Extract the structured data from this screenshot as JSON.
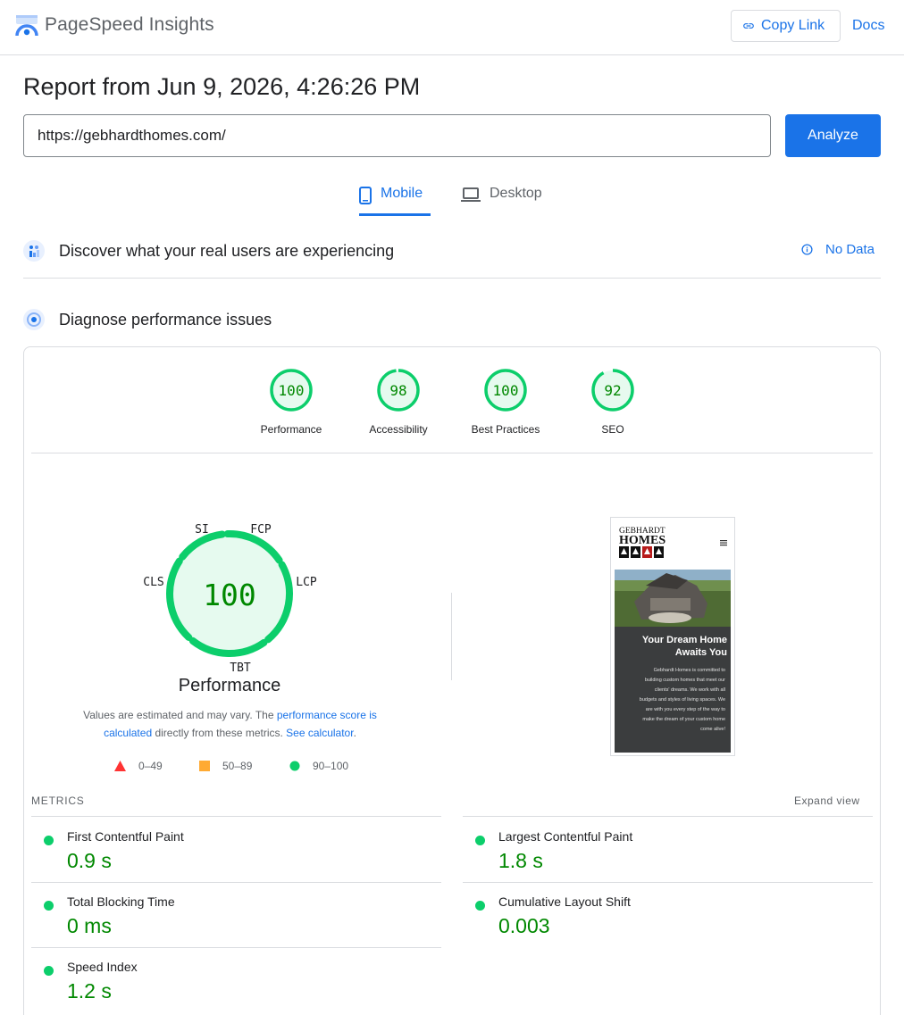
{
  "header": {
    "brand": "PageSpeed Insights",
    "copy_link": "Copy Link",
    "docs": "Docs"
  },
  "report": {
    "title": "Report from Jun 9, 2026, 4:26:26 PM",
    "url": "https://gebhardthomes.com/",
    "analyze": "Analyze"
  },
  "tabs": [
    {
      "label": "Mobile",
      "selected": true
    },
    {
      "label": "Desktop",
      "selected": false
    }
  ],
  "field_data": {
    "title": "Discover what your real users are experiencing",
    "status": "No Data"
  },
  "diagnose": {
    "title": "Diagnose performance issues"
  },
  "scores": [
    {
      "label": "Performance",
      "value": "100",
      "fraction": 1.0
    },
    {
      "label": "Accessibility",
      "value": "98",
      "fraction": 0.98
    },
    {
      "label": "Best Practices",
      "value": "100",
      "fraction": 1.0
    },
    {
      "label": "SEO",
      "value": "92",
      "fraction": 0.92
    }
  ],
  "performance": {
    "score": "100",
    "title": "Performance",
    "segments": [
      "SI",
      "FCP",
      "LCP",
      "TBT",
      "CLS"
    ],
    "note_pre": "Values are estimated and may vary. The ",
    "note_link1": "performance score is calculated",
    "note_mid": " directly from these metrics. ",
    "note_link2": "See calculator",
    "note_post": "."
  },
  "legend": [
    {
      "range": "0–49",
      "shape": "triangle",
      "color": "#ff3333"
    },
    {
      "range": "50–89",
      "shape": "square",
      "color": "#ffaa33"
    },
    {
      "range": "90–100",
      "shape": "circle",
      "color": "#0cce6b"
    }
  ],
  "thumbnail": {
    "logo_top": "GEBHARDT",
    "logo_bottom": "HOMES",
    "headline": "Your Dream Home Awaits You",
    "body": "Gebhardt Homes is committed to building custom homes that meet our clients' dreams. We work with all budgets and styles of living spaces. We are with you every step of the way to make the dream of your custom home come alive!"
  },
  "metrics": {
    "heading": "METRICS",
    "expand": "Expand view",
    "items": [
      {
        "name": "First Contentful Paint",
        "value": "0.9 s"
      },
      {
        "name": "Largest Contentful Paint",
        "value": "1.8 s"
      },
      {
        "name": "Total Blocking Time",
        "value": "0 ms"
      },
      {
        "name": "Cumulative Layout Shift",
        "value": "0.003"
      },
      {
        "name": "Speed Index",
        "value": "1.2 s"
      }
    ]
  },
  "colors": {
    "accent": "#1a73e8",
    "pass": "#0cce6b",
    "pass_text": "#008800",
    "pass_fill": "#e6faef"
  }
}
